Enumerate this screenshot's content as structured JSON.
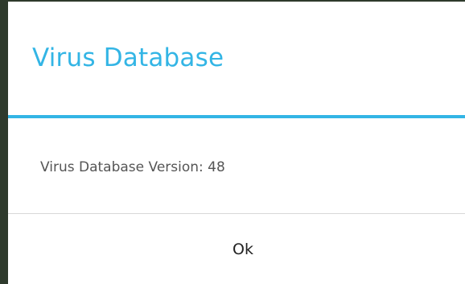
{
  "dialog": {
    "title": "Virus Database",
    "message": "Virus Database Version: 48",
    "ok_label": "Ok"
  },
  "colors": {
    "accent": "#33b5e5",
    "dialog_background": "#ffffff",
    "screen_background": "#2e3a2c",
    "message_text": "#555555",
    "button_text": "#222222",
    "divider": "#d8d8d8"
  }
}
